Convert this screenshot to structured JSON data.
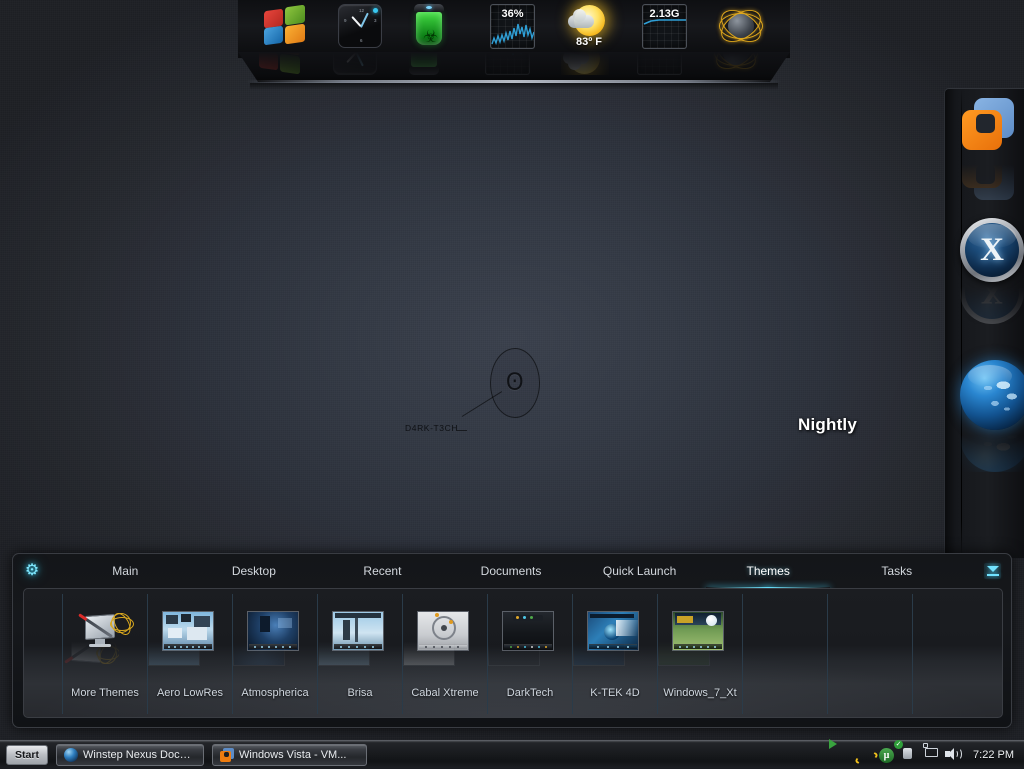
{
  "desktop": {
    "wallpaper": {
      "logo_text": "D4RK-T3CH",
      "logo_glyph": "ʘ",
      "nightly_label": "Nightly"
    },
    "background_color": "#2c313b",
    "accent_color": "#4fd8fb"
  },
  "top_dock": {
    "items": [
      {
        "name": "windows-start-orb",
        "label": "Windows",
        "icon": "windows-logo-icon",
        "value": ""
      },
      {
        "name": "clock-widget",
        "label": "Clock",
        "icon": "analog-clock-icon",
        "value": ""
      },
      {
        "name": "recycle-bin",
        "label": "Recycle Bin",
        "icon": "biohazard-bin-icon",
        "value": ""
      },
      {
        "name": "cpu-meter",
        "label": "CPU",
        "icon": "cpu-graph-icon",
        "value": "36%"
      },
      {
        "name": "weather-widget",
        "label": "Weather",
        "icon": "sun-cloud-icon",
        "value": "83º F"
      },
      {
        "name": "memory-meter",
        "label": "Memory",
        "icon": "memory-graph-icon",
        "value": "2.13G"
      },
      {
        "name": "network-widget",
        "label": "Network",
        "icon": "atom-globe-icon",
        "value": ""
      }
    ]
  },
  "right_dock": {
    "items": [
      {
        "name": "vmware-workstation",
        "label": "VMware",
        "icon": "vmware-icon"
      },
      {
        "name": "xion-player",
        "label": "Xion",
        "icon": "x-circle-icon",
        "glyph": "X"
      },
      {
        "name": "browser-globe",
        "label": "Globe",
        "icon": "blue-globe-icon"
      }
    ]
  },
  "nexus_dock": {
    "settings_icon": "gear-icon",
    "collapse_icon": "collapse-down-icon",
    "tabs": [
      {
        "label": "Main",
        "active": false
      },
      {
        "label": "Desktop",
        "active": false
      },
      {
        "label": "Recent",
        "active": false
      },
      {
        "label": "Documents",
        "active": false
      },
      {
        "label": "Quick Launch",
        "active": false
      },
      {
        "label": "Themes",
        "active": true
      },
      {
        "label": "Tasks",
        "active": false
      }
    ],
    "themes": [
      {
        "label": "More Themes",
        "icon": "more-themes-icon",
        "thumb": "none"
      },
      {
        "label": "Aero LowRes",
        "icon": "theme-thumbnail",
        "thumb": "aero"
      },
      {
        "label": "Atmospherica",
        "icon": "theme-thumbnail",
        "thumb": "atmospherica"
      },
      {
        "label": "Brisa",
        "icon": "theme-thumbnail",
        "thumb": "brisa"
      },
      {
        "label": "Cabal Xtreme",
        "icon": "theme-thumbnail",
        "thumb": "cabal"
      },
      {
        "label": "DarkTech",
        "icon": "theme-thumbnail",
        "thumb": "darktech"
      },
      {
        "label": "K-TEK 4D",
        "icon": "theme-thumbnail",
        "thumb": "ktek"
      },
      {
        "label": "Windows_7_Xt",
        "icon": "theme-thumbnail",
        "thumb": "win7"
      },
      {
        "label": "",
        "icon": "empty-slot",
        "thumb": "none"
      },
      {
        "label": "",
        "icon": "empty-slot",
        "thumb": "none"
      }
    ]
  },
  "taskbar": {
    "start_label": "Start",
    "tasks": [
      {
        "label": "Winstep Nexus Dock ...",
        "icon": "globe-icon"
      },
      {
        "label": "Windows Vista - VM...",
        "icon": "vmware-icon"
      }
    ],
    "tray": [
      {
        "name": "diamond-icon"
      },
      {
        "name": "media-share-icon"
      },
      {
        "name": "internet-explorer-icon"
      },
      {
        "name": "utorrent-icon",
        "glyph": "µ"
      },
      {
        "name": "safely-remove-hardware-icon",
        "glyph": "✓"
      },
      {
        "name": "network-icon"
      },
      {
        "name": "volume-icon"
      }
    ],
    "clock": "7:22 PM"
  }
}
